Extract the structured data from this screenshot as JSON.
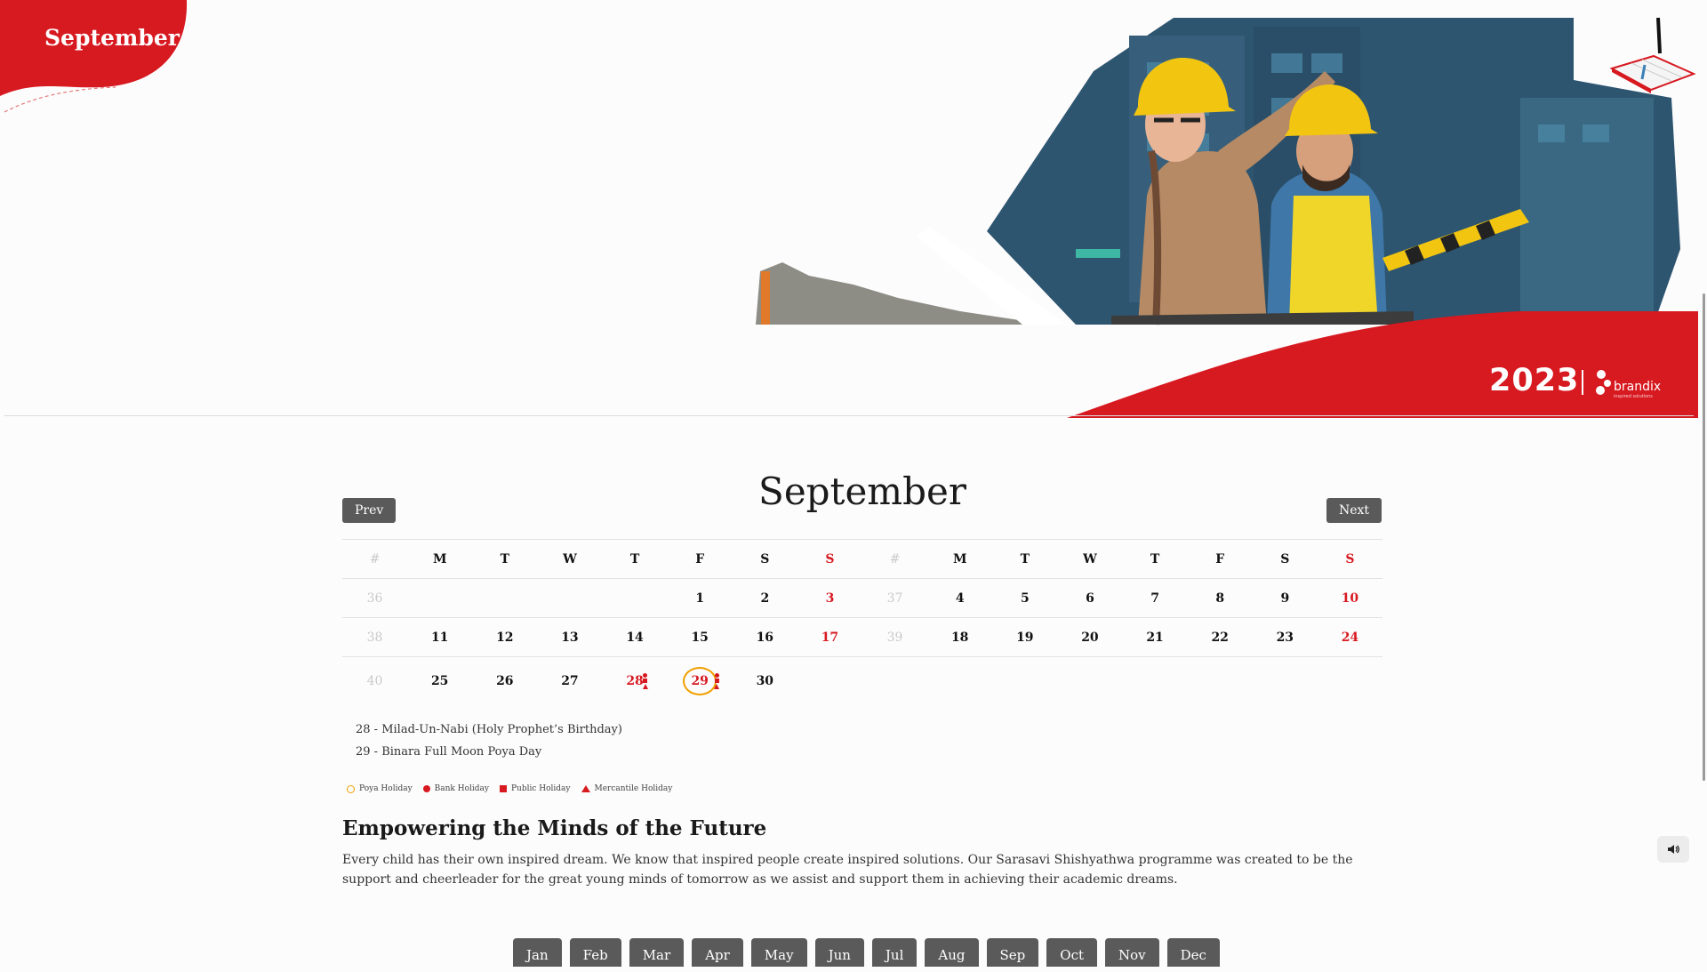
{
  "badge": {
    "month": "September"
  },
  "branding": {
    "year": "2023",
    "brand_name": "brandix",
    "brand_tagline": "inspired solutions"
  },
  "calendar": {
    "title": "September",
    "prev_label": "Prev",
    "next_label": "Next",
    "headers": [
      "#",
      "M",
      "T",
      "W",
      "T",
      "F",
      "S",
      "S",
      "#",
      "M",
      "T",
      "W",
      "T",
      "F",
      "S",
      "S"
    ],
    "rows": [
      [
        "36",
        "",
        "",
        "",
        "",
        "1",
        "2",
        "3",
        "37",
        "4",
        "5",
        "6",
        "7",
        "8",
        "9",
        "10"
      ],
      [
        "38",
        "11",
        "12",
        "13",
        "14",
        "15",
        "16",
        "17",
        "39",
        "18",
        "19",
        "20",
        "21",
        "22",
        "23",
        "24"
      ],
      [
        "40",
        "25",
        "26",
        "27",
        "28",
        "29",
        "30",
        "",
        "",
        "",
        "",
        "",
        "",
        "",
        "",
        ""
      ]
    ],
    "holidays": [
      {
        "text": "28 - Milad-Un-Nabi (Holy Prophet’s Birthday)"
      },
      {
        "text": "29 - Binara Full Moon Poya Day"
      }
    ],
    "legend": {
      "poya": "Poya Holiday",
      "bank": "Bank Holiday",
      "public": "Public Holiday",
      "mercantile": "Mercantile Holiday"
    }
  },
  "article": {
    "title": "Empowering the Minds of the Future",
    "body": "Every child has their own inspired dream. We know that inspired people create inspired solutions. Our Sarasavi Shishyathwa programme was created to be the support and cheerleader for the great young minds of tomorrow as we assist and support them in achieving their academic dreams."
  },
  "months": [
    "Jan",
    "Feb",
    "Mar",
    "Apr",
    "May",
    "Jun",
    "Jul",
    "Aug",
    "Sep",
    "Oct",
    "Nov",
    "Dec"
  ],
  "colors": {
    "accent": "#d71920",
    "button": "#5a5a5a",
    "poya": "#f0a000"
  },
  "icons": {
    "sound": "speaker-icon",
    "notebook": "notebook-pen-icon",
    "brand": "brandix-logo-icon"
  }
}
